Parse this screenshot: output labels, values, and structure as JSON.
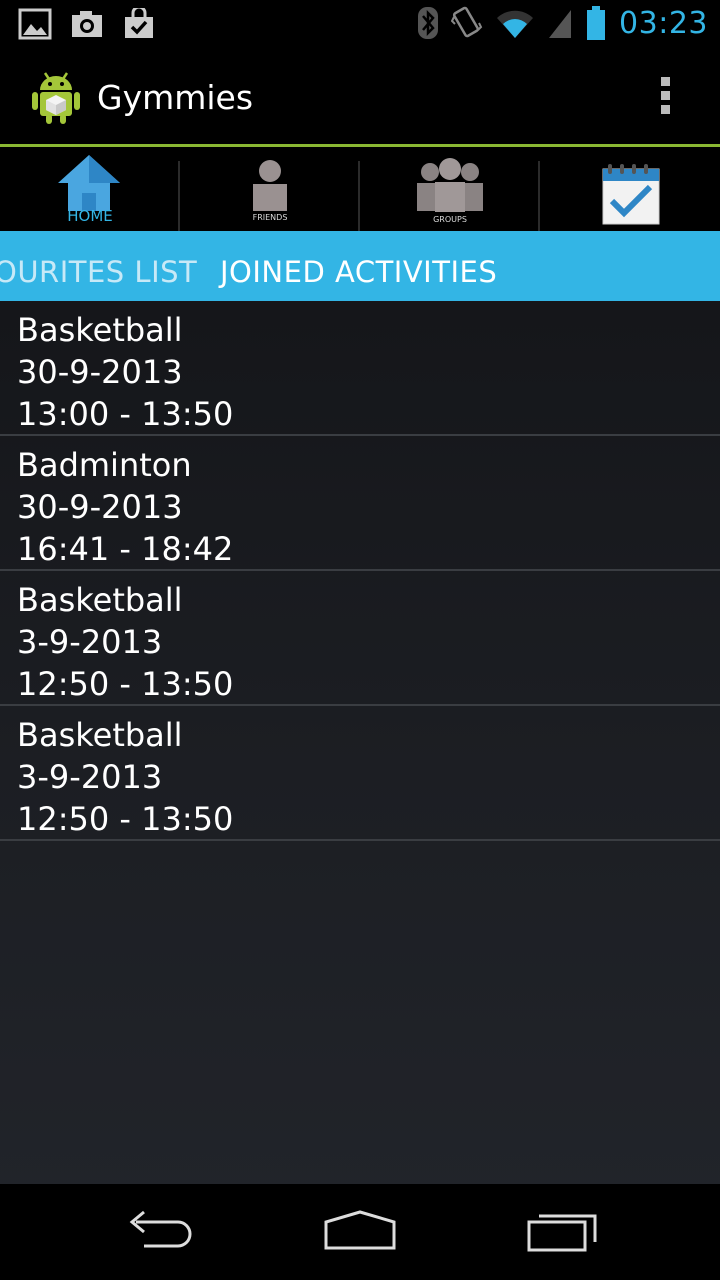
{
  "status_bar": {
    "notification_icons": [
      "gallery-icon",
      "camera-icon",
      "shopping-bag-check-icon"
    ],
    "system_icons": [
      "bluetooth-icon",
      "vibrate-icon",
      "wifi-icon",
      "signal-icon",
      "battery-icon"
    ],
    "time": "03:23",
    "clock_color": "#33b5e5"
  },
  "action_bar": {
    "title": "Gymmies",
    "accent_color": "#8ab833"
  },
  "icon_tabs": [
    {
      "label": "HOME",
      "icon": "home-icon",
      "label_color": "#33b5e5"
    },
    {
      "label": "FRIENDS",
      "icon": "friend-icon"
    },
    {
      "label": "GROUPS",
      "icon": "groups-icon"
    },
    {
      "label": "",
      "icon": "calendar-check-icon",
      "selected": true
    }
  ],
  "tab_header": {
    "background": "#33b5e5",
    "previous_tab": "OURITES LIST",
    "current_tab": "JOINED ACTIVITIES"
  },
  "activities": [
    {
      "name": "Basketball",
      "date": "30-9-2013",
      "time": "13:00 - 13:50"
    },
    {
      "name": "Badminton",
      "date": "30-9-2013",
      "time": "16:41 - 18:42"
    },
    {
      "name": "Basketball",
      "date": "3-9-2013",
      "time": "12:50 - 13:50"
    },
    {
      "name": "Basketball",
      "date": "3-9-2013",
      "time": "12:50 - 13:50"
    }
  ],
  "nav_bar": {
    "buttons": [
      "back-icon",
      "home-icon",
      "recent-apps-icon"
    ]
  }
}
